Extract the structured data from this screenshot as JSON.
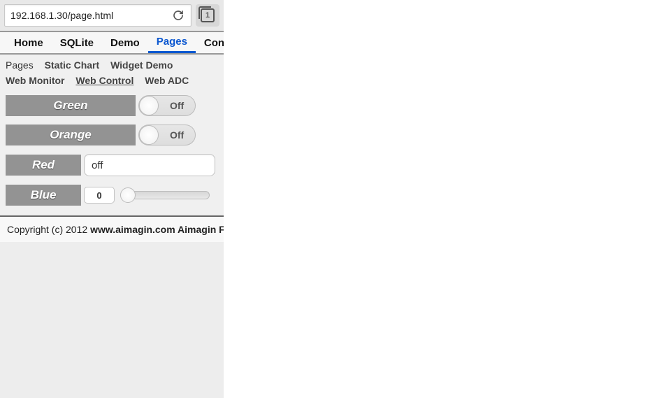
{
  "chrome": {
    "url": "192.168.1.30/page.html",
    "tab_count": "1"
  },
  "nav": {
    "items": [
      "Home",
      "SQLite",
      "Demo",
      "Pages",
      "Con"
    ],
    "active_index": 3
  },
  "subnav": {
    "row1": [
      "Pages",
      "Static Chart",
      "Widget Demo"
    ],
    "row2": [
      "Web Monitor",
      "Web Control",
      "Web ADC"
    ],
    "active": "Web Control"
  },
  "controls": {
    "green": {
      "label": "Green",
      "state_text": "Off"
    },
    "orange": {
      "label": "Orange",
      "state_text": "Off"
    },
    "red": {
      "label": "Red",
      "value": "off"
    },
    "blue": {
      "label": "Blue",
      "value": "0"
    }
  },
  "footer": {
    "prefix": "Copyright (c) 2012 ",
    "link": "www.aimagin.com",
    "suffix": " Aimagin F"
  }
}
